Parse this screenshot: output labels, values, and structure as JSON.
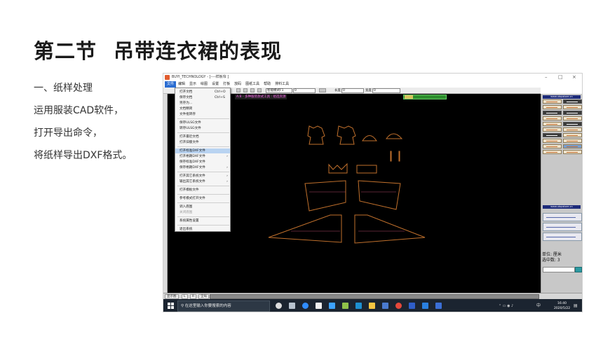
{
  "slide": {
    "title_part1": "第二节",
    "title_part2": "吊带连衣裙的表现",
    "lines": [
      "一、纸样处理",
      "运用服装CAD软件，",
      "打开导出命令，",
      "将纸样导出DXF格式。"
    ]
  },
  "app": {
    "window_title": "BUYI_TECHNOLOGY - [----样板帘 ]",
    "menu": [
      "文件",
      "编辑",
      "显示",
      "绘图",
      "设置",
      "打板",
      "放码",
      "图纸工具",
      "帮助",
      "排料工具"
    ],
    "toolbar": {
      "mode_value": "智能模式F1",
      "field1_value": "0",
      "length_label": "长度",
      "length_value": "0",
      "width_label": "宽度",
      "width_value": "0"
    },
    "canvas_tab": "A:B - 多种服装款式工具 : 组选资源",
    "file_menu": [
      {
        "label": "打开文档",
        "shortcut": "Ctrl+O"
      },
      {
        "label": "保存文档",
        "shortcut": "Ctrl+S"
      },
      {
        "label": "另存为..."
      },
      {
        "label": "文档精简"
      },
      {
        "label": "文件批转存"
      },
      {
        "label": "保存ULSG文件"
      },
      {
        "label": "转存ULSG文件"
      },
      {
        "label": "打开最近文档"
      },
      {
        "label": "打开旧版文件"
      },
      {
        "label": "打开标准DXF文件",
        "highlighted": true
      },
      {
        "label": "打开格朗DXF文件",
        "submenu": true
      },
      {
        "label": "保存标准DXF文件"
      },
      {
        "label": "保存格朗DXF文件",
        "submenu": true
      },
      {
        "label": "打开其它系统文件",
        "submenu": true
      },
      {
        "label": "输出其它系统文件",
        "submenu": true
      },
      {
        "label": "打开模板文件"
      },
      {
        "label": "参考模式打开文件"
      },
      {
        "label": "调入底图"
      },
      {
        "label": "关闭底图",
        "disabled": true
      },
      {
        "label": "系统属性设置"
      },
      {
        "label": "退出系统"
      }
    ],
    "right_panel": {
      "header1": "www.utopstore.cn",
      "header2": "www.utopstore.cn",
      "unit_text": "单位: 厘米",
      "selected_text": "选中数: 3"
    },
    "status_bar": {
      "cell1": "显示图",
      "cell2": "L",
      "cell3": "R",
      "cell4": "全局"
    },
    "taskbar": {
      "search_placeholder": "在这里输入你要搜索的内容",
      "tray_text": "中",
      "time": "16:40",
      "date": "2020/5/22"
    }
  }
}
